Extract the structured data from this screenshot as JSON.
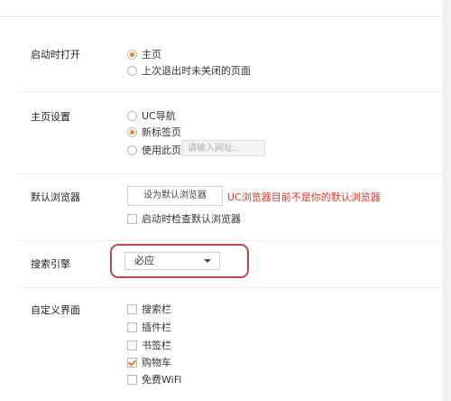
{
  "startup": {
    "label": "启动时打开",
    "options": [
      "主页",
      "上次退出时未关闭的页面"
    ],
    "selected_index": 0
  },
  "homepage": {
    "label": "主页设置",
    "options": [
      "UC导航",
      "新标签页",
      "使用此页"
    ],
    "selected_index": 1,
    "url_placeholder": "请输入网址..."
  },
  "default_browser": {
    "label": "默认浏览器",
    "button_label": "设为默认浏览器",
    "warning": "UC浏览器目前不是你的默认浏览器",
    "check_on_start_label": "启动时检查默认浏览器",
    "check_on_start_checked": false
  },
  "search_engine": {
    "label": "搜索引擎",
    "selected": "必应"
  },
  "custom_ui": {
    "label": "自定义界面",
    "items": [
      {
        "label": "搜索栏",
        "checked": false
      },
      {
        "label": "插件栏",
        "checked": false
      },
      {
        "label": "书签栏",
        "checked": false
      },
      {
        "label": "购物车",
        "checked": true
      },
      {
        "label": "免费WiFi",
        "checked": false
      }
    ]
  },
  "colors": {
    "accent": "#f07d1e",
    "warning": "#d23b2f",
    "highlight_border": "#b9494a"
  }
}
